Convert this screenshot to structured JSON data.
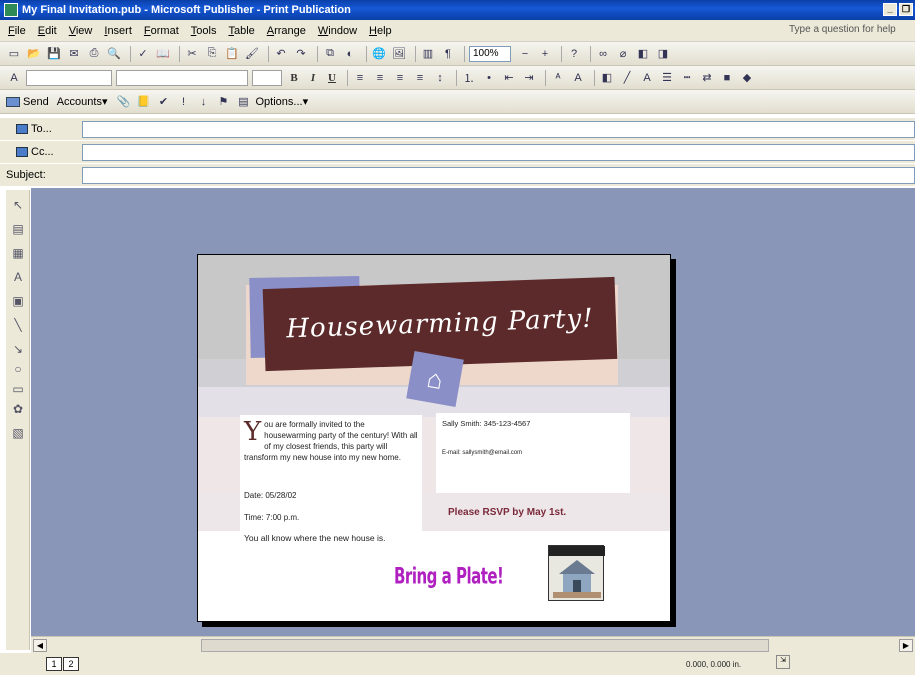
{
  "window": {
    "title": "My Final Invitation.pub - Microsoft Publisher - Print Publication"
  },
  "menu": {
    "items": [
      "File",
      "Edit",
      "View",
      "Insert",
      "Format",
      "Tools",
      "Table",
      "Arrange",
      "Window",
      "Help"
    ],
    "help_placeholder": "Type a question for help"
  },
  "toolbar": {
    "zoom": "100%"
  },
  "email_toolbar": {
    "send": "Send",
    "accounts": "Accounts",
    "options": "Options..."
  },
  "email_header": {
    "to_label": "To...",
    "cc_label": "Cc...",
    "subject_label": "Subject:",
    "to_value": "",
    "cc_value": "",
    "subject_value": ""
  },
  "invitation": {
    "title": "Housewarming Party!",
    "dropcap": "Y",
    "body": "ou are formally invited to the housewarming party of the century! With all of my closest friends, this party will transform my new house into my new home.",
    "date": "Date: 05/28/02",
    "time": "Time: 7:00 p.m.",
    "where": "You all know where the new house is.",
    "contact_phone": "Sally Smith: 345-123-4567",
    "contact_email": "E-mail: sallysmith@email.com",
    "rsvp": "Please RSVP by May 1st.",
    "bring": "Bring a Plate!"
  },
  "status": {
    "pages": [
      "1",
      "2"
    ],
    "coords": "0.000, 0.000 in."
  },
  "colors": {
    "titlebar": "#0a3fa8",
    "canvas": "#8a96b8",
    "banner": "#5c2a2a",
    "accent_purple": "#b020c0"
  }
}
